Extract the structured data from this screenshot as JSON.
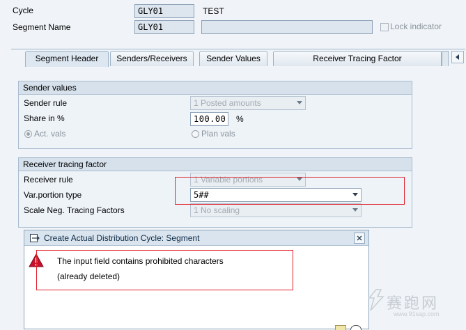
{
  "header": {
    "cycle_label": "Cycle",
    "cycle_value": "GLY01",
    "cycle_text": "TEST",
    "segment_label": "Segment Name",
    "segment_value": "GLY01",
    "segment_text": "",
    "lock_label": "Lock indicator"
  },
  "tabs": [
    {
      "label": "Segment Header"
    },
    {
      "label": "Senders/Receivers"
    },
    {
      "label": "Sender Values"
    },
    {
      "label": "Receiver Tracing Factor"
    }
  ],
  "sender_values": {
    "title": "Sender values",
    "sender_rule_label": "Sender rule",
    "sender_rule_value": "1 Posted amounts",
    "share_label": "Share in %",
    "share_value": "100.00",
    "share_unit": "%",
    "act_vals_label": "Act. vals",
    "plan_vals_label": "Plan vals"
  },
  "receiver_tracing": {
    "title": "Receiver tracing factor",
    "receiver_rule_label": "Receiver rule",
    "receiver_rule_value": "1 Variable portions",
    "var_portion_label": "Var.portion type",
    "var_portion_value": "5##",
    "scale_label": "Scale Neg. Tracing Factors",
    "scale_value": "1 No scaling"
  },
  "dialog": {
    "title": "Create Actual Distribution Cycle: Segment",
    "line1": "The input field contains prohibited characters",
    "line2": "(already deleted)"
  },
  "watermark": {
    "text": "赛跑网",
    "url": "www.91sap.com"
  },
  "colors": {
    "highlight": "#e0202a",
    "error_icon": "#c8102e"
  }
}
